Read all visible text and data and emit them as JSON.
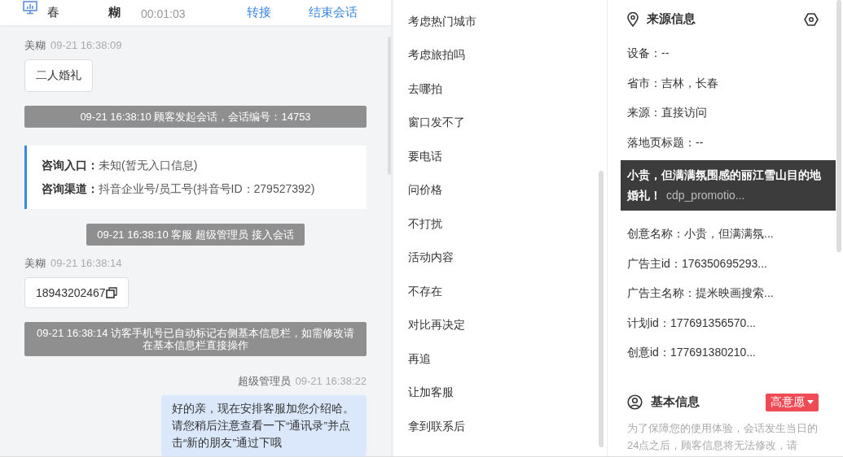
{
  "header": {
    "location": "春",
    "customer": "糊",
    "duration": "00:01:03",
    "actions": [
      "转接",
      "结束会话"
    ]
  },
  "messages": [
    {
      "kind": "customer",
      "name": "美糊",
      "time": "09-21 16:38:09",
      "text": "二人婚礼"
    },
    {
      "kind": "system",
      "text": "09-21 16:38:10 顾客发起会话，会话编号：14753"
    },
    {
      "kind": "info",
      "rows": [
        {
          "label": "咨询入口：",
          "value": "未知(暂无入口信息)"
        },
        {
          "label": "咨询渠道：",
          "value": "抖音企业号/员工号(抖音号ID：279527392)"
        }
      ]
    },
    {
      "kind": "system",
      "text": "09-21 16:38:10 客服 超级管理员 接入会话"
    },
    {
      "kind": "customer",
      "name": "美糊",
      "time": "09-21 16:38:14",
      "text": "18943202467",
      "copyable": true
    },
    {
      "kind": "system",
      "text": "09-21 16:38:14 访客手机号已自动标记右侧基本信息栏，如需修改请在基本信息栏直接操作"
    },
    {
      "kind": "agent",
      "name": "超级管理员",
      "time": "09-21 16:38:22",
      "text": "好的亲，现在安排客服加您介绍哈。请您稍后注意查看一下“通讯录”并点击“新的朋友”通过下哦"
    }
  ],
  "phrases": [
    "考虑热门城市",
    "考虑旅拍吗",
    "去哪拍",
    "窗口发不了",
    "要电话",
    "问价格",
    "不打扰",
    "活动内容",
    "不存在",
    "对比再决定",
    "再追",
    "让加客服",
    "拿到联系后"
  ],
  "source": {
    "title": "来源信息",
    "rows_before": [
      "设备：--",
      "省市：吉林，长春",
      "来源：直接访问",
      "落地页标题：--"
    ],
    "tooltip": {
      "text": "小贵，但满满氛围感的丽江雪山目的地婚礼！",
      "partial": "cdp_promotio..."
    },
    "rows_after": [
      "创意名称：小贵，但满满氛...",
      "广告主id：176350695293...",
      "广告主名称：提米映画搜索...",
      "计划id：177691356570...",
      "创意id：177691380210..."
    ]
  },
  "basic": {
    "title": "基本信息",
    "intent": "高意愿",
    "note": "为了保障您的使用体验，会话发生当日的24点之后，顾客信息将无法修改，请"
  }
}
